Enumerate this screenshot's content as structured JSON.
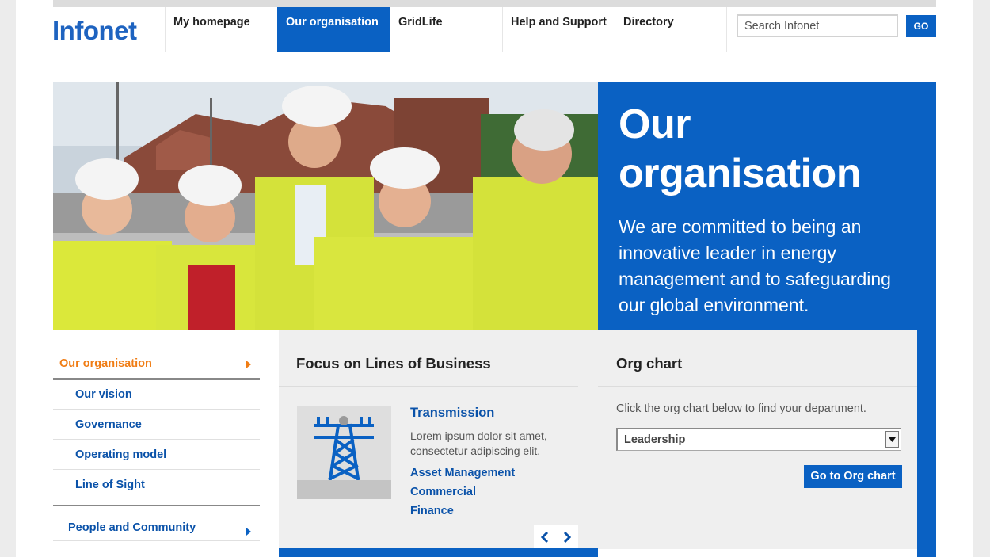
{
  "header": {
    "logo": "Infonet",
    "nav": [
      {
        "label": "My homepage"
      },
      {
        "label": "Our organisation"
      },
      {
        "label": "GridLife"
      },
      {
        "label": "Help and Support"
      },
      {
        "label": "Directory"
      }
    ],
    "search": {
      "placeholder": "Search Infonet",
      "go_label": "GO"
    }
  },
  "hero": {
    "title_line1": "Our",
    "title_line2": "organisation",
    "text": "We are committed to being an innovative leader in energy management and to safeguarding our global environment."
  },
  "left_nav": {
    "current": "Our organisation",
    "sub_items": [
      {
        "label": "Our vision"
      },
      {
        "label": "Governance"
      },
      {
        "label": "Operating model"
      },
      {
        "label": "Line of Sight"
      }
    ],
    "group": "People and Community"
  },
  "focus": {
    "title": "Focus on Lines of Business",
    "item_title": "Transmission",
    "item_desc": "Lorem ipsum dolor sit amet, consectetur adipiscing elit.",
    "links": [
      {
        "label": "Asset Management"
      },
      {
        "label": "Commercial"
      },
      {
        "label": "Finance"
      }
    ]
  },
  "org_chart": {
    "title": "Org chart",
    "text": "Click the org chart below to find your department.",
    "selected": "Leadership",
    "button": "Go to Org chart"
  },
  "colors": {
    "brand_blue": "#0a61c3",
    "accent_orange": "#f07c13"
  }
}
